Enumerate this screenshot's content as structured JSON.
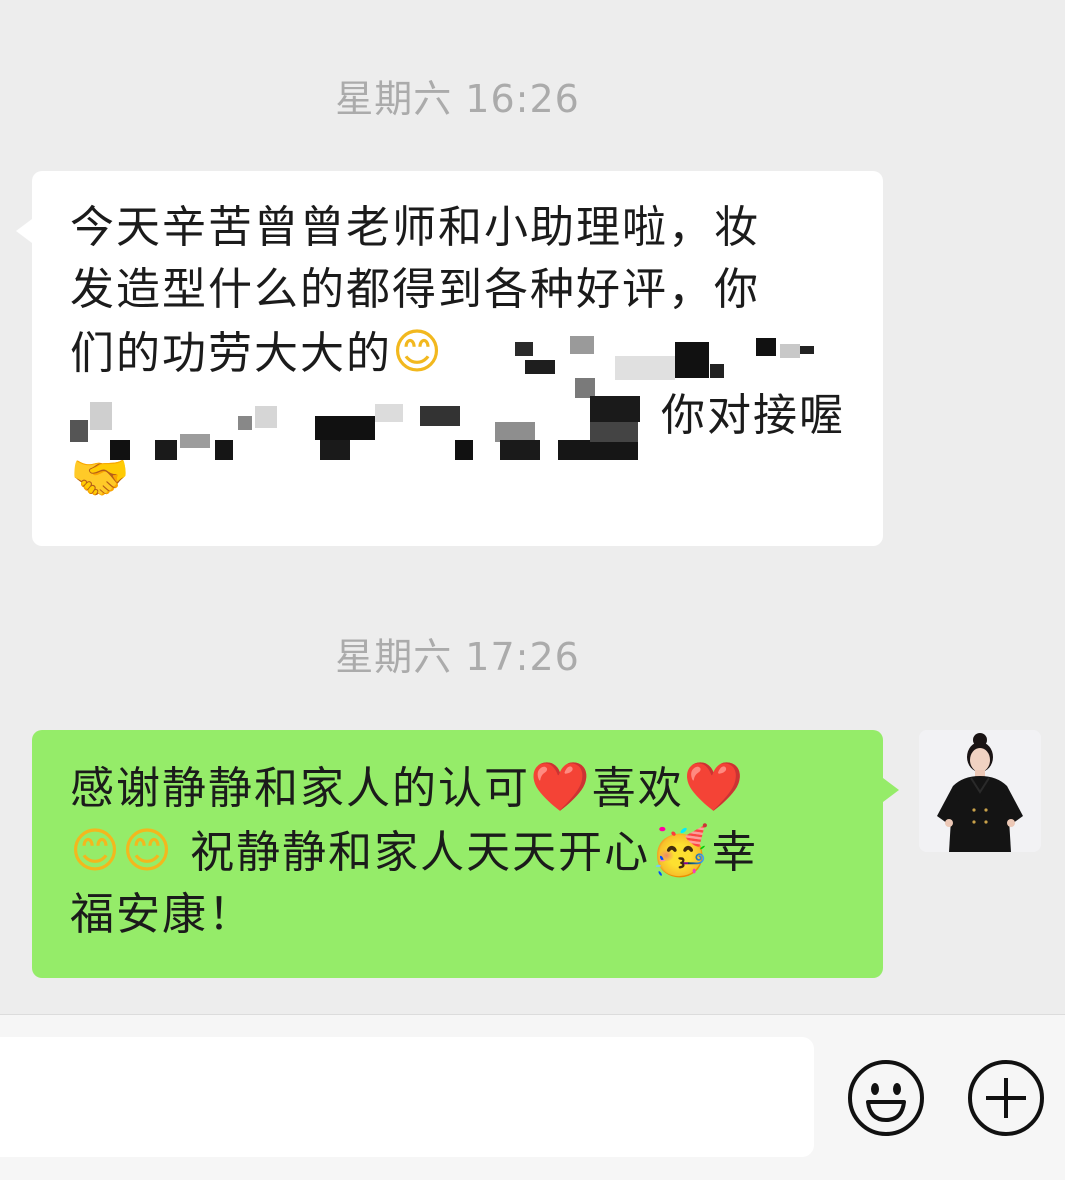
{
  "timestamps": {
    "first": "星期六 16:26",
    "second": "星期六 17:26"
  },
  "messages": {
    "incoming": {
      "line1": "今天辛苦曾曾老师和小助理啦，妆",
      "line2": "发造型什么的都得到各种好评，你",
      "line3_visible": "们的功劳大大的",
      "line4_visible_tail": "你对接喔",
      "emoji_smile": "😊",
      "emoji_handshake": "🤝"
    },
    "outgoing": {
      "part1": "感谢静静和家人的认可",
      "heart1": "❤️",
      "part2": "喜欢",
      "heart2": "❤️",
      "smile1": "😊",
      "smile2": "😊",
      "part3": " 祝静静和家人天天开心",
      "party": "🥳",
      "part4": "幸",
      "part5": "福安康！"
    }
  },
  "input": {
    "placeholder": "",
    "value": ""
  },
  "icons": {
    "emoji_button": "smiley-icon",
    "plus_button": "plus-circle-icon"
  },
  "colors": {
    "background": "#ededed",
    "incoming_bubble": "#ffffff",
    "outgoing_bubble": "#95ec69",
    "timestamp": "#ababab"
  }
}
